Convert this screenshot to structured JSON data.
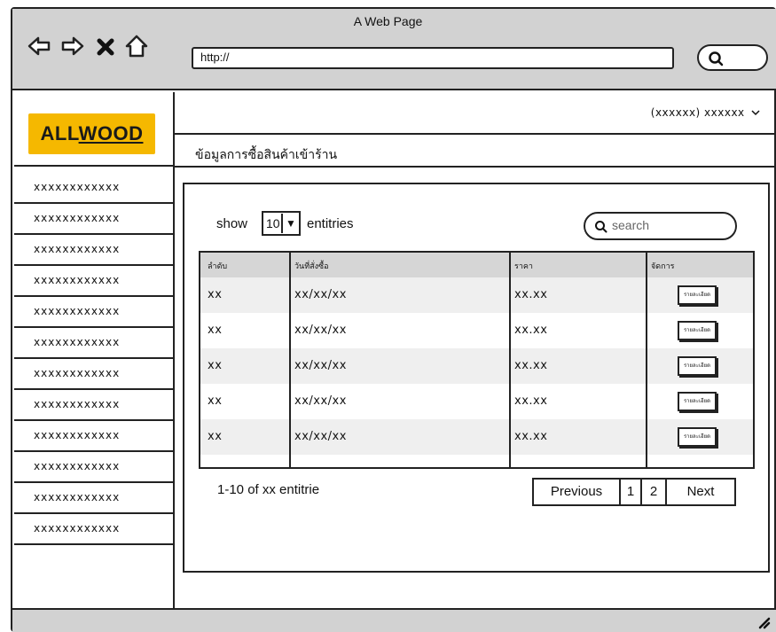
{
  "window": {
    "title": "A Web Page"
  },
  "toolbar": {
    "url": "http://",
    "back_icon": "back-arrow-icon",
    "forward_icon": "forward-arrow-icon",
    "stop_icon": "close-icon",
    "home_icon": "home-icon",
    "search_icon": "search-icon"
  },
  "brand": {
    "logo_a": "ALL",
    "logo_b": "WOOD",
    "color": "#f5b800"
  },
  "sidebar": {
    "items": [
      {
        "label": "xxxxxxxxxxxx"
      },
      {
        "label": "xxxxxxxxxxxx"
      },
      {
        "label": "xxxxxxxxxxxx"
      },
      {
        "label": "xxxxxxxxxxxx"
      },
      {
        "label": "xxxxxxxxxxxx"
      },
      {
        "label": "xxxxxxxxxxxx"
      },
      {
        "label": "xxxxxxxxxxxx"
      },
      {
        "label": "xxxxxxxxxxxx"
      },
      {
        "label": "xxxxxxxxxxxx"
      },
      {
        "label": "xxxxxxxxxxxx"
      },
      {
        "label": "xxxxxxxxxxxx"
      },
      {
        "label": "xxxxxxxxxxxx"
      }
    ]
  },
  "header": {
    "user_menu": "(xxxxxx) xxxxxx"
  },
  "page": {
    "title": "ข้อมูลการซื้อสินค้าเข้าร้าน"
  },
  "table_controls": {
    "show_label": "show",
    "page_size": "10",
    "entries_label": "entitries",
    "search_placeholder": "search"
  },
  "table": {
    "columns": [
      "ลำดับ",
      "วันที่สั่งซื้อ",
      "ราคา",
      "จัดการ"
    ],
    "rows": [
      {
        "no": "xx",
        "date": "xx/xx/xx",
        "price": "xx.xx",
        "action": "รายละเอียด"
      },
      {
        "no": "xx",
        "date": "xx/xx/xx",
        "price": "xx.xx",
        "action": "รายละเอียด"
      },
      {
        "no": "xx",
        "date": "xx/xx/xx",
        "price": "xx.xx",
        "action": "รายละเอียด"
      },
      {
        "no": "xx",
        "date": "xx/xx/xx",
        "price": "xx.xx",
        "action": "รายละเอียด"
      },
      {
        "no": "xx",
        "date": "xx/xx/xx",
        "price": "xx.xx",
        "action": "รายละเอียด"
      }
    ]
  },
  "footer": {
    "info": "1-10 of xx entitrie",
    "pagination": {
      "previous": "Previous",
      "pages": [
        "1",
        "2"
      ],
      "next": "Next"
    }
  }
}
